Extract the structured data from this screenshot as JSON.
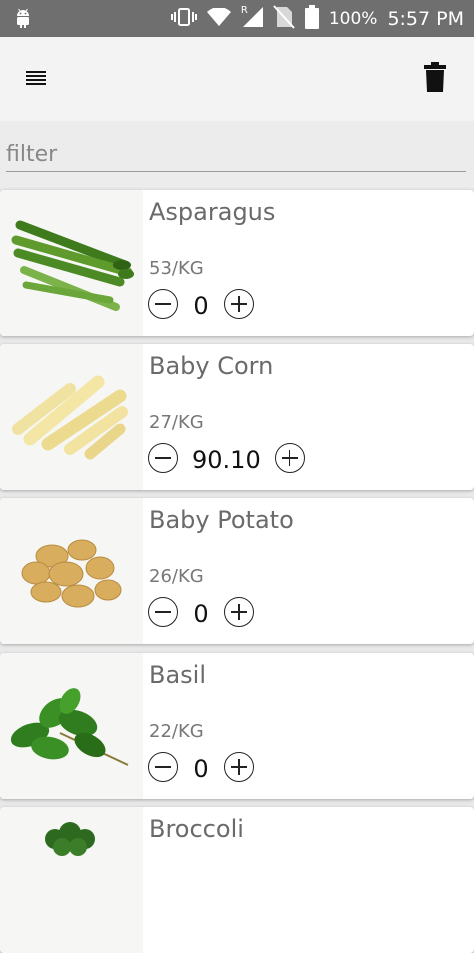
{
  "status_bar": {
    "battery_pct": "100%",
    "time": "5:57 PM",
    "network": "R",
    "icons": [
      "android-icon",
      "vibrate-icon",
      "wifi-icon",
      "signal-icon",
      "no-sim-icon",
      "battery-icon"
    ]
  },
  "toolbar": {
    "menu_icon": "menu-icon",
    "delete_icon": "trash-icon"
  },
  "filter": {
    "placeholder": "filter",
    "value": ""
  },
  "products": [
    {
      "name": "Asparagus",
      "price": "53/KG",
      "qty": "0",
      "image": "asparagus-image"
    },
    {
      "name": "Baby Corn",
      "price": "27/KG",
      "qty": "90.10",
      "image": "baby-corn-image"
    },
    {
      "name": "Baby Potato",
      "price": "26/KG",
      "qty": "0",
      "image": "baby-potato-image"
    },
    {
      "name": "Basil",
      "price": "22/KG",
      "qty": "0",
      "image": "basil-image"
    },
    {
      "name": "Broccoli",
      "price": "",
      "qty": "",
      "image": "broccoli-image"
    }
  ]
}
